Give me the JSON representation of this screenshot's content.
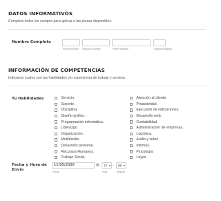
{
  "datos": {
    "title": "DATOS INFORMATIVOS",
    "description": "Completa todos los campos para aplicar a las plazas disponibles."
  },
  "nombre": {
    "label": "Nombre Completo",
    "first_name": "Primer Nombre",
    "second_name": "Segundo Nombre",
    "first_surname": "Primer Apellido",
    "second_surname": "Segundo Apellido"
  },
  "competencias": {
    "title": "INFORMACIÓN DE COMPETENCIAS",
    "description": "Indícanos cuales son tus habilidades y/o experiencia de trabajo y servicio."
  },
  "habilidades": {
    "label": "Tu Habilidades",
    "left": [
      "Servicio.",
      "Soporte.",
      "Disciplina.",
      "Diseño gráfico.",
      "Programación informática.",
      "Liderazgo.",
      "Organización.",
      "Multimedia.",
      "Desarrollo personal.",
      "Recursos Humanos.",
      "Trabajo Social."
    ],
    "right": [
      "Atención al cliente.",
      "Proactividad.",
      "Ejecución de indicaciones.",
      "Desarrollo web.",
      "Contabilidad.",
      "Administración de empresas.",
      "Logística.",
      "Audio y video.",
      "Idiomas.",
      "Psicología",
      "Leyes."
    ]
  },
  "fecha_hora": {
    "label_line1": "Fecha y Hora de",
    "label_line2": "Envío",
    "date_value": "11/05/2026",
    "date_label": "Fecha",
    "hour_value": "12",
    "hour_label": "Hora",
    "minute_value": "58",
    "minute_label": "Minutos",
    "separator": ":"
  },
  "icons": {
    "calendar": "calendar-icon",
    "chevron": "chevron-down-icon"
  }
}
